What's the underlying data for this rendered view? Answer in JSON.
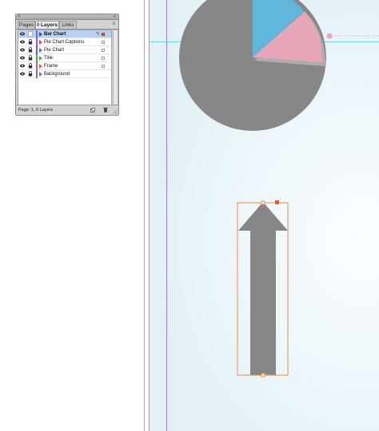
{
  "panel": {
    "tabs": [
      {
        "label": "Pages",
        "active": false
      },
      {
        "label": "Layers",
        "active": true
      },
      {
        "label": "Links",
        "active": false
      }
    ],
    "layers": [
      {
        "name": "Bar Chart",
        "color": "#4a7ee0",
        "selected": true,
        "locked": false,
        "current": true
      },
      {
        "name": "Pie Chart Captions",
        "color": "#c640c6",
        "selected": false,
        "locked": true,
        "current": false
      },
      {
        "name": "Pie Chart",
        "color": "#5a5adf",
        "selected": false,
        "locked": true,
        "current": false
      },
      {
        "name": "Title",
        "color": "#4ca84c",
        "selected": false,
        "locked": true,
        "current": false
      },
      {
        "name": "Frame",
        "color": "#e05a5a",
        "selected": false,
        "locked": true,
        "current": false
      },
      {
        "name": "Background",
        "color": "#6a6adf",
        "selected": false,
        "locked": true,
        "current": false
      }
    ],
    "status": "Page: 1, 6 Layers"
  },
  "colors": {
    "pie_gray": "#878787",
    "pie_blue": "#5fb8dc",
    "pie_pink": "#e6a6b8",
    "arrow_gray": "#878787",
    "selection_orange": "#f08a3a",
    "guide_cyan": "#6cd3ee",
    "margin_violet": "#9b79d8"
  }
}
